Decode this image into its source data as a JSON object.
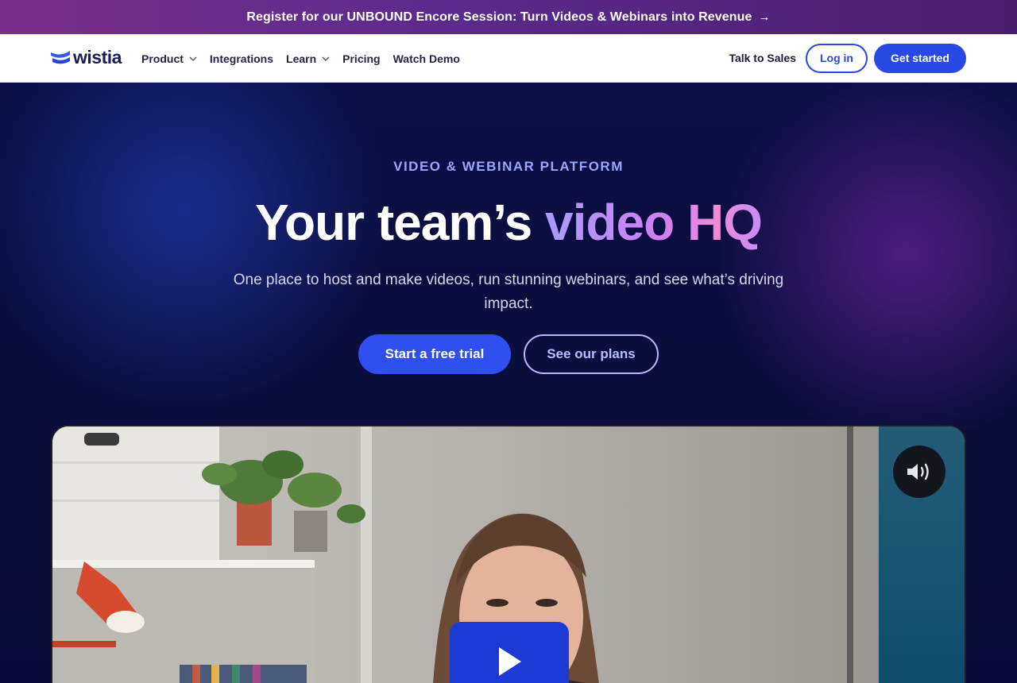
{
  "banner": {
    "text": "Register for our UNBOUND Encore Session: Turn Videos & Webinars into Revenue",
    "arrow": "→"
  },
  "nav": {
    "logo_text": "wistia",
    "links": [
      {
        "label": "Product",
        "has_dropdown": true
      },
      {
        "label": "Integrations",
        "has_dropdown": false
      },
      {
        "label": "Learn",
        "has_dropdown": true
      },
      {
        "label": "Pricing",
        "has_dropdown": false
      },
      {
        "label": "Watch Demo",
        "has_dropdown": false
      }
    ],
    "talk_to_sales": "Talk to Sales",
    "login": "Log in",
    "get_started": "Get started"
  },
  "hero": {
    "eyebrow": "VIDEO & WEBINAR PLATFORM",
    "headline_plain": "Your team’s ",
    "headline_gradient": "video HQ",
    "subheadline": "One place to host and make videos, run stunning webinars, and see what’s driving impact.",
    "cta_primary": "Start a free trial",
    "cta_secondary": "See our plans"
  },
  "video": {
    "sound_icon": "volume-icon",
    "play_icon": "play-icon"
  },
  "colors": {
    "brand_blue": "#2949e5",
    "navy": "#0a0e3a",
    "banner_purple": "#5a2a8c",
    "gradient_start": "#a99bff",
    "gradient_end": "#f08ad8"
  }
}
